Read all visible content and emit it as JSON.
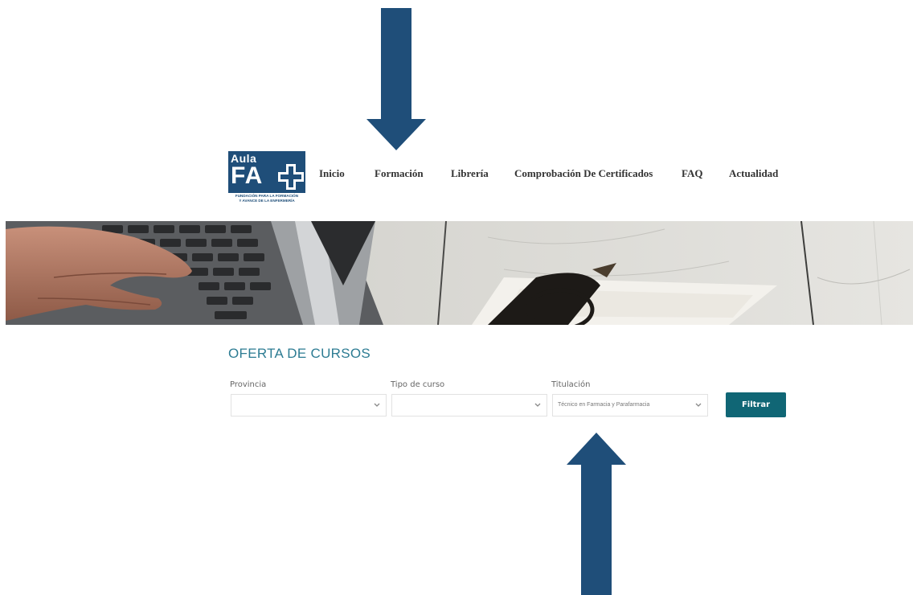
{
  "logo": {
    "aula": "Aula",
    "fa": "FA",
    "tagline_1": "FUNDACIÓN PARA LA FORMACIÓN",
    "tagline_2": "Y AVANCE DE LA ENFERMERÍA"
  },
  "nav": {
    "items": [
      {
        "label": "Inicio"
      },
      {
        "label": "Formación"
      },
      {
        "label": "Librería"
      },
      {
        "label": "Comprobación De Certificados"
      },
      {
        "label": "FAQ"
      },
      {
        "label": "Actualidad"
      }
    ]
  },
  "section": {
    "title": "OFERTA DE CURSOS"
  },
  "filters": {
    "provincia": {
      "label": "Provincia",
      "value": ""
    },
    "tipo": {
      "label": "Tipo de curso",
      "value": ""
    },
    "titulacion": {
      "label": "Titulación",
      "value": "Técnico en Farmacia y Parafarmacia"
    },
    "submit_label": "Filtrar"
  },
  "colors": {
    "brand": "#1f4e79",
    "accent": "#106675",
    "title": "#2d7c93",
    "arrow": "#1f4e79"
  },
  "icons": {
    "arrow_down": "arrow-down-icon",
    "arrow_up": "arrow-up-icon",
    "chevron": "chevron-down-icon"
  }
}
